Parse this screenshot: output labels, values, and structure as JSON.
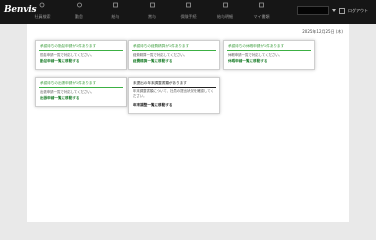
{
  "header": {
    "logo": "Benvis",
    "nav": [
      "社員検索",
      "勤怠",
      "給与",
      "賞与",
      "保険手続",
      "給与明細",
      "マイ書類"
    ],
    "user_name": "",
    "logout_label": "ログアウト"
  },
  "main": {
    "date": "2025年12月25日 (木)",
    "cards": [
      {
        "id": "card-1",
        "title": "承認待ちの勤怠申請が1件あります",
        "desc": "勤怠申請一覧で対応してください。",
        "link": "勤怠申請一覧に移動する",
        "style": "green"
      },
      {
        "id": "card-2",
        "title": "承認待ちの経費精算が1件あります",
        "desc": "経費精算一覧で対応してください。",
        "link": "経費精算一覧に移動する",
        "style": "green"
      },
      {
        "id": "card-3",
        "title": "承認待ちの休暇申請が1件あります",
        "desc": "休暇申請一覧で対応してください。",
        "link": "休暇申請一覧に移動する",
        "style": "green"
      },
      {
        "id": "card-4",
        "title": "承認待ちの出張申請が1件あります",
        "desc": "出張申請一覧で対応してください。",
        "link": "出張申請一覧に移動する",
        "style": "green"
      },
      {
        "id": "card-5",
        "title": "未提出の年末調整書類があります",
        "desc": "年末調整書類について、社員の提出状況を確認してください。",
        "link": "年末調整一覧に移動する",
        "style": "black"
      }
    ]
  },
  "colors": {
    "topbar": "#161616",
    "accent_green": "#3cb043",
    "link_green": "#1b7e2a",
    "background": "#e9e9e9"
  }
}
